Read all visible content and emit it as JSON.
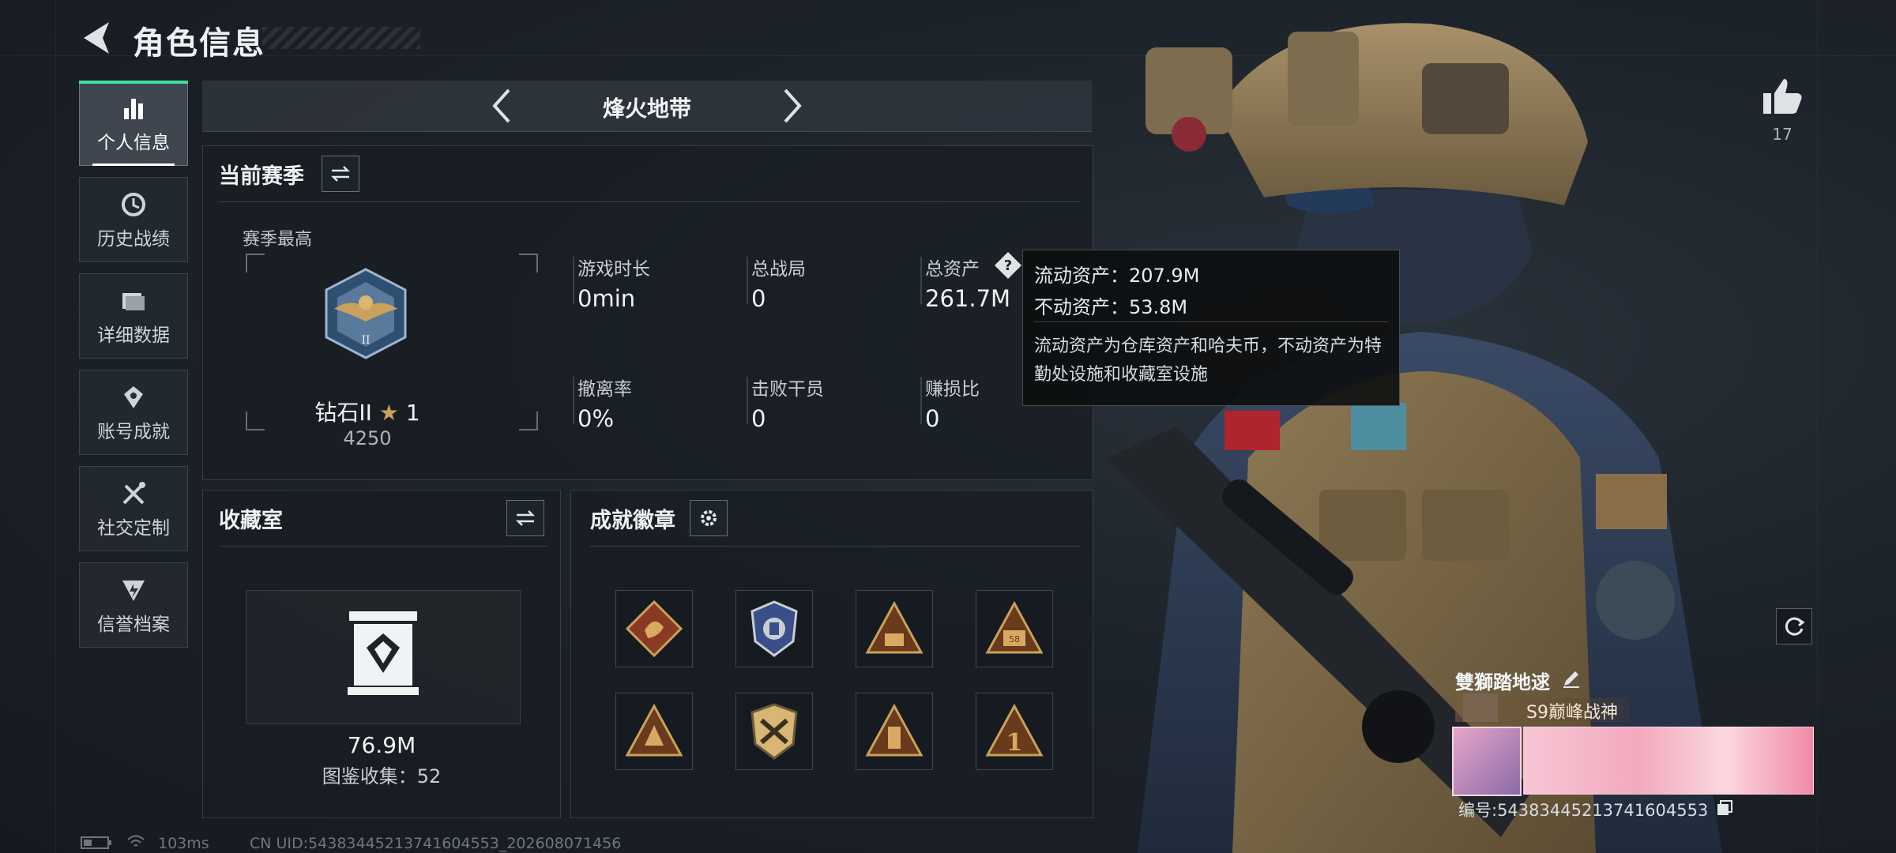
{
  "header": {
    "title": "角色信息"
  },
  "nav": {
    "items": [
      {
        "label": "个人信息",
        "icon": "bar-chart-icon",
        "active": true
      },
      {
        "label": "历史战绩",
        "icon": "history-clock-icon"
      },
      {
        "label": "详细数据",
        "icon": "folder-icon"
      },
      {
        "label": "账号成就",
        "icon": "achievement-icon"
      },
      {
        "label": "社交定制",
        "icon": "tools-icon"
      },
      {
        "label": "信誉档案",
        "icon": "reputation-icon"
      }
    ]
  },
  "mode": {
    "title": "烽火地带"
  },
  "season": {
    "title": "当前赛季",
    "best_label": "赛季最高",
    "rank_name": "钻石II",
    "rank_stars": "1",
    "rank_points": "4250",
    "stats": [
      {
        "label": "游戏时长",
        "value": "0min"
      },
      {
        "label": "总战局",
        "value": "0"
      },
      {
        "label": "总资产",
        "value": "261.7M"
      },
      {
        "label": "撤离率",
        "value": "0%"
      },
      {
        "label": "击败干员",
        "value": "0"
      },
      {
        "label": "赚损比",
        "value": "0"
      }
    ]
  },
  "tooltip": {
    "liquid": "流动资产：207.9M",
    "fixed": "不动资产：53.8M",
    "note": "流动资产为仓库资产和哈夫币，不动资产为特勤处设施和收藏室设施"
  },
  "collection": {
    "title": "收藏室",
    "value": "76.9M",
    "count_text": "图鉴收集：52"
  },
  "badges": {
    "title": "成就徽章",
    "items": [
      "dragon-badge-icon",
      "shield-badge-icon",
      "squad-badge-icon",
      "vehicle-badge-icon",
      "triangle-badge-icon",
      "crossed-arms-badge-icon",
      "building-badge-icon",
      "number-one-badge-icon"
    ]
  },
  "profile": {
    "likes": "17",
    "player_name": "雙獅踏地逑",
    "title_badge": "S9巅峰战神",
    "player_id": "编号:54383445213741604553"
  },
  "footer": {
    "ping": "103ms",
    "uid": "CN UID:54383445213741604553_202608071456"
  },
  "colors": {
    "accent": "#3fe0a0",
    "gold": "#c9a15a"
  }
}
